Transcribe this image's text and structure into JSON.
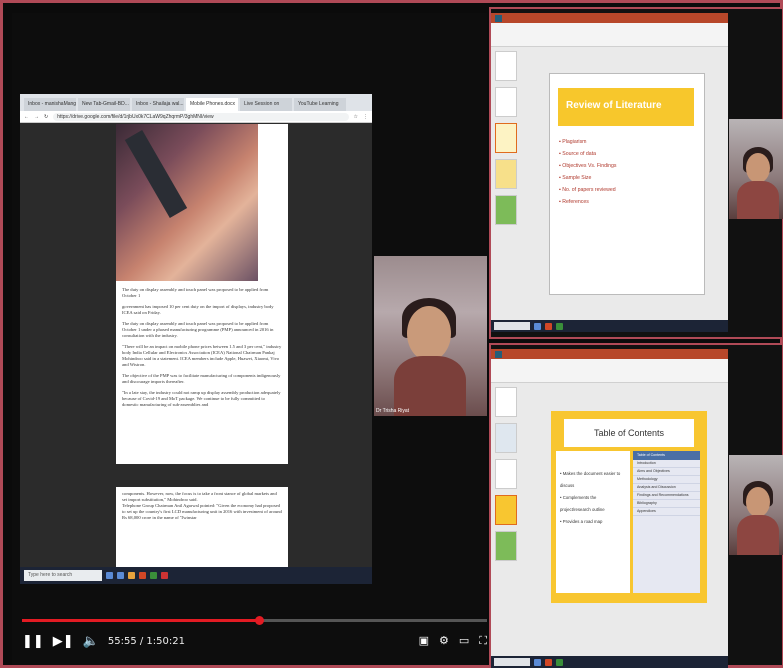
{
  "colors": {
    "accent": "#b04a57",
    "youtube_red": "#e31b23",
    "ppt_orange": "#b7472a",
    "slide_yellow": "#f7c72c"
  },
  "browser": {
    "tabs": [
      "Inbox - manishaMangal",
      "New Tab-Gmail-BD...",
      "Inbox - Shailaja wal...",
      "Mobile Phones.docx",
      "Live Session on",
      "YouTube Learning"
    ],
    "address": "https://drive.google.com/file/d/1rjbUx0k7CLaW9qZhqrmP/3ghMNI/view",
    "doc_paragraphs": [
      "The duty on display assembly and touch panel was proposed to be applied from October 1",
      "government has imposed 10 per cent duty on the import of displays, industry body ICEA said on Friday.",
      "The duty on display assembly and touch panel was proposed to be applied from October 1 under a phased manufacturing programme (PMP) announced in 2016 in consultation with the industry.",
      "\"There will be an impact on mobile phone prices between 1.5 and 3 per cent,\" industry body India Cellular and Electronics Association (ICEA) National Chairman Pankaj Mohindroo said in a statement. ICEA members include Apple, Huawei, Xiaomi, Vivo and Wistron.",
      "The objective of the PMP was to facilitate manufacturing of components indigenously and discourage imports thereafter.",
      "\"In a late stay, the industry could not ramp up display assembly production adequately because of Covid-19 and MoT package. We continue to be fully committed to domestic manufacturing of sub-assemblies and"
    ],
    "page2_paragraphs": [
      "components. However, now, the focus is to take a front stance of global markets and set import substitution,\" Mohindroo said.",
      "Telephone Group Chairman Anil Agarwal pointed: \"Given the economy had proposed to set up the country's first LCD manufacturing unit in 2016 with investment of around Rs 68,000 crore in the name of 'Twinstar"
    ],
    "search_placeholder": "Type here to search"
  },
  "participant_main": {
    "name": "Dr Trisha Riyat"
  },
  "player": {
    "current_time": "55:55",
    "duration": "1:50:21",
    "time_display": "55:55 / 1:50:21",
    "progress_fraction": 0.51
  },
  "slide1": {
    "title": "Review of Literature",
    "bullets": [
      "Plagiarism",
      "Source of data",
      "Objectives Vs. Findings",
      "Sample Size",
      "No. of papers reviewed",
      "References"
    ]
  },
  "slide2": {
    "title": "Table of Contents",
    "left_bullets": [
      "Makes the document easier to discuss",
      "Complements the project/research outline",
      "Provides a road map"
    ],
    "right_header": "Table of Contents",
    "right_items": [
      "Introduction",
      "Aims and Objectives",
      "Methodology",
      "Analysis and Discussion",
      "Findings and Recommendations",
      "Bibliography",
      "Appendices"
    ]
  }
}
